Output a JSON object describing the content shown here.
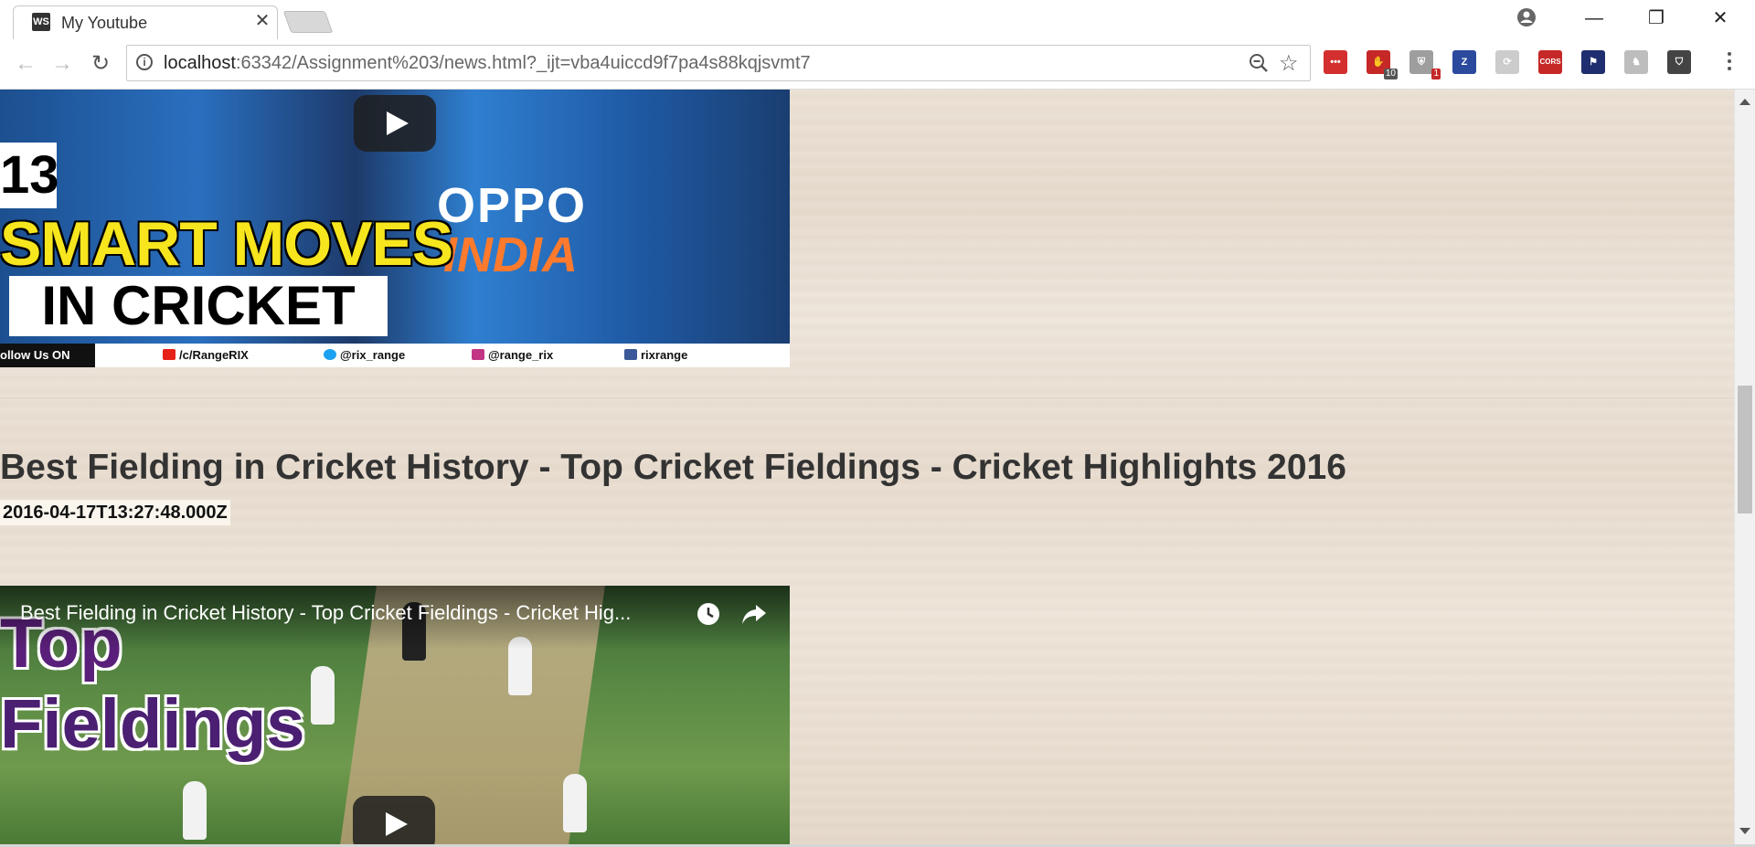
{
  "browser": {
    "tab_title": "My Youtube",
    "tab_favicon_text": "WS",
    "tab_close": "✕",
    "url_host": "localhost",
    "url_rest": ":63342/Assignment%203/news.html?_ijt=vba4uiccd9f7pa4s88kqjsvmt7",
    "window_controls": {
      "minimize": "—",
      "restore": "❐",
      "close": "✕"
    },
    "extensions": [
      {
        "name": "lastpass-ext-icon",
        "label": "•••",
        "color": "#d32f2f",
        "badge": ""
      },
      {
        "name": "adblock-ext-icon",
        "label": "✋",
        "color": "#c62828",
        "badge": "10",
        "badge_color": "#555"
      },
      {
        "name": "ublock-ext-icon",
        "label": "⛨",
        "color": "#9e9e9e",
        "badge": "1",
        "badge_color": "#c62828"
      },
      {
        "name": "zotero-ext-icon",
        "label": "Z",
        "color": "#2b4a9e",
        "badge": ""
      },
      {
        "name": "sync-ext-icon",
        "label": "⟳",
        "color": "#cccccc",
        "badge": ""
      },
      {
        "name": "cors-ext-icon",
        "label": "CORS",
        "color": "#c62828",
        "badge": ""
      },
      {
        "name": "flag-ext-icon",
        "label": "⚑",
        "color": "#1f2e6e",
        "badge": ""
      },
      {
        "name": "person-ext-icon",
        "label": "♞",
        "color": "#bdbdbd",
        "badge": ""
      },
      {
        "name": "shield-ext-icon",
        "label": "⛉",
        "color": "#444444",
        "badge": ""
      }
    ]
  },
  "video1": {
    "number": "13",
    "headline": "SMART MOVES",
    "subheadline": "IN CRICKET",
    "jersey_brand": "OPPO",
    "jersey_country": "INDIA",
    "follow_label": "ollow Us ON",
    "social": [
      {
        "name": "youtube",
        "text": "/c/RangeRIX",
        "color": "#e62117"
      },
      {
        "name": "twitter",
        "text": "@rix_range",
        "color": "#1da1f2"
      },
      {
        "name": "instagram",
        "text": "@range_rix",
        "color": "#c13584"
      },
      {
        "name": "facebook",
        "text": "rixrange",
        "color": "#3b5998"
      }
    ]
  },
  "video2": {
    "title": "Best Fielding in Cricket History - Top Cricket Fieldings - Cricket Highlights 2016",
    "published": "2016-04-17T13:27:48.000Z",
    "overlay_title": "Best Fielding in Cricket History - Top Cricket Fieldings - Cricket Hig...",
    "thumb_top_text": "Top",
    "thumb_bottom_text": "Fieldings"
  }
}
